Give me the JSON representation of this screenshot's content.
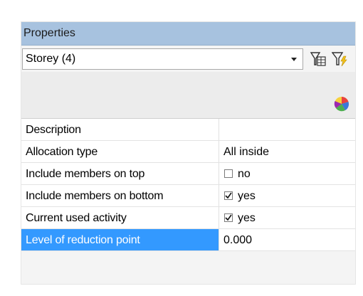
{
  "panel": {
    "title": "Properties"
  },
  "selector": {
    "value": "Storey (4)",
    "icons": [
      "filter-table-icon",
      "filter-lightning-icon",
      "color-palette-icon"
    ]
  },
  "properties": [
    {
      "name": "Description",
      "value": "",
      "type": "text"
    },
    {
      "name": "Allocation type",
      "value": "All inside",
      "type": "text"
    },
    {
      "name": "Include members on top",
      "value": "no",
      "type": "checkbox",
      "checked": false
    },
    {
      "name": "Include members on bottom",
      "value": "yes",
      "type": "checkbox",
      "checked": true
    },
    {
      "name": "Current used activity",
      "value": "yes",
      "type": "checkbox",
      "checked": true
    },
    {
      "name": "Level of reduction point",
      "value": "0.000",
      "type": "text",
      "selected": true
    }
  ],
  "colors": {
    "titlebar": "#a7c2df",
    "selection": "#3399ff"
  }
}
